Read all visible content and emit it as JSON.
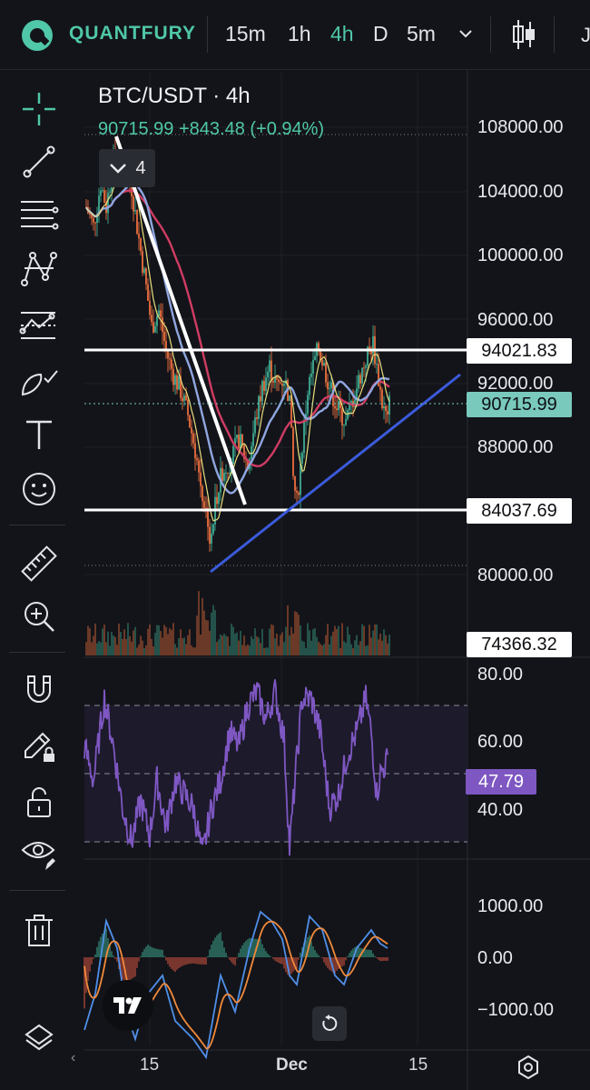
{
  "app": {
    "brand": "QUANTFURY"
  },
  "toolbar": {
    "timeframes": [
      "15m",
      "1h",
      "4h",
      "D",
      "5m"
    ],
    "active_timeframe": "4h",
    "cutoff_text": "J"
  },
  "chart": {
    "symbol": "BTC/USDT · 4h",
    "quote": "90715.99 +843.48 (+0.94%)",
    "indicator_count": "4",
    "price_axis": [
      "108000.00",
      "104000.00",
      "100000.00",
      "96000.00",
      "92000.00",
      "88000.00",
      "80000.00"
    ],
    "tags": {
      "resistance": "94021.83",
      "current": "90715.99",
      "support": "84037.69",
      "volume": "74366.32"
    }
  },
  "rsi": {
    "axis": [
      "80.00",
      "60.00",
      "40.00"
    ],
    "current": "47.79"
  },
  "macd": {
    "axis": [
      "1000.00",
      "0.00",
      "−1000.00"
    ]
  },
  "time_axis": [
    "15",
    "Dec",
    "15"
  ],
  "colors": {
    "accent": "#4fc7a8",
    "up": "#3a9c86",
    "down": "#d4653a",
    "ma_slow": "#d03c63",
    "ma_mid": "#8fa6e0",
    "ma_fast": "#e9df7e",
    "trendline": "#3b5bdb",
    "rsi": "#7e57c2"
  },
  "sidebar": {
    "tools": [
      "crosshair-icon",
      "trendline-icon",
      "fib-icon",
      "pattern-icon",
      "prediction-icon",
      "brush-icon",
      "text-icon",
      "emoji-icon",
      "ruler-icon",
      "zoom-in-icon",
      "magnet-icon",
      "lock-drawing-icon",
      "unlock-icon",
      "eye-icon",
      "trash-icon",
      "layers-icon"
    ]
  }
}
